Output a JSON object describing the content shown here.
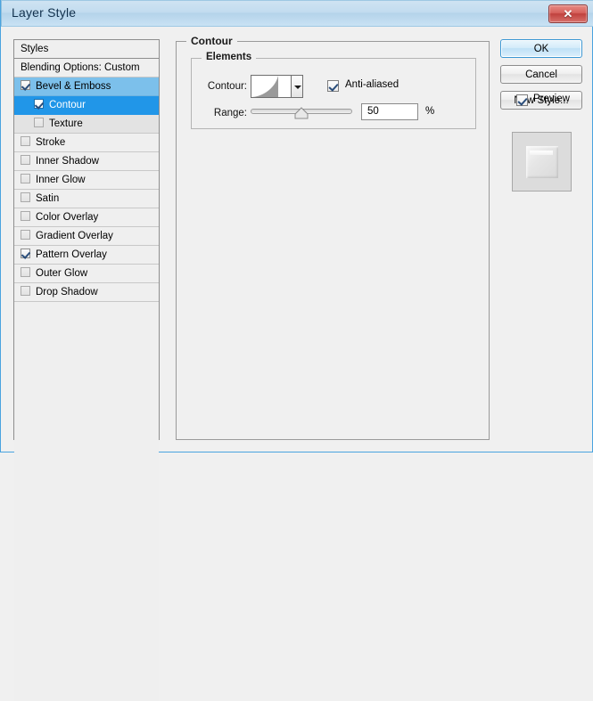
{
  "window": {
    "title": "Layer Style",
    "close_label": "✕"
  },
  "sidebar": {
    "header": "Styles",
    "blending_options": "Blending Options: Custom",
    "items": [
      {
        "label": "Bevel & Emboss",
        "checked": true,
        "selected": "light",
        "indent": false
      },
      {
        "label": "Contour",
        "checked": true,
        "selected": "dark",
        "indent": true
      },
      {
        "label": "Texture",
        "checked": false,
        "selected": "pale",
        "indent": true
      },
      {
        "label": "Stroke",
        "checked": false,
        "selected": "none",
        "indent": false
      },
      {
        "label": "Inner Shadow",
        "checked": false,
        "selected": "none",
        "indent": false
      },
      {
        "label": "Inner Glow",
        "checked": false,
        "selected": "none",
        "indent": false
      },
      {
        "label": "Satin",
        "checked": false,
        "selected": "none",
        "indent": false
      },
      {
        "label": "Color Overlay",
        "checked": false,
        "selected": "none",
        "indent": false
      },
      {
        "label": "Gradient Overlay",
        "checked": false,
        "selected": "none",
        "indent": false
      },
      {
        "label": "Pattern Overlay",
        "checked": true,
        "selected": "none",
        "indent": false
      },
      {
        "label": "Outer Glow",
        "checked": false,
        "selected": "none",
        "indent": false
      },
      {
        "label": "Drop Shadow",
        "checked": false,
        "selected": "none",
        "indent": false
      }
    ]
  },
  "main": {
    "group_title": "Contour",
    "elements_title": "Elements",
    "contour_label": "Contour:",
    "anti_aliased_label": "Anti-aliased",
    "anti_aliased_checked": true,
    "range_label": "Range:",
    "range_value": "50",
    "range_percent_sign": "%",
    "range_slider_position": 50
  },
  "buttons": {
    "ok": "OK",
    "cancel": "Cancel",
    "new_style": "New Style...",
    "preview": "Preview",
    "preview_checked": true
  },
  "colors": {
    "titlebar": "#c2dcef",
    "selection_dark": "#2196e8",
    "selection_light": "#7cc0eb",
    "accent_border": "#4aa3df",
    "close_red": "#c0413d",
    "dialog_bg": "#f0f0f0"
  }
}
